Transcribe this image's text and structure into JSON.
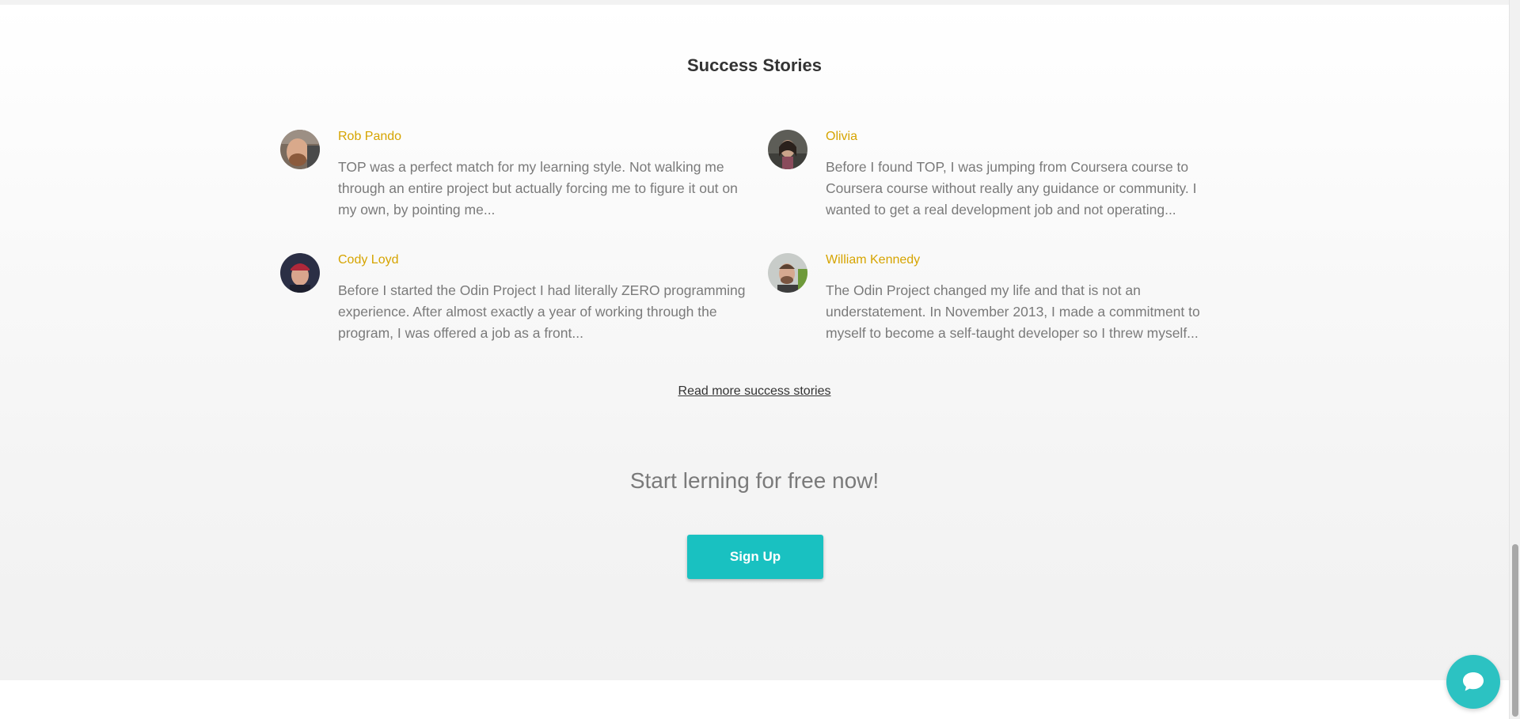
{
  "section": {
    "title": "Success Stories",
    "read_more_label": "Read more success stories"
  },
  "stories": [
    {
      "name": "Rob Pando",
      "quote": "TOP was a perfect match for my learning style. Not walking me through an entire project but actually forcing me to figure it out on my own, by pointing me..."
    },
    {
      "name": "Olivia",
      "quote": "Before I found TOP, I was jumping from Coursera course to Coursera course without really any guidance or community. I wanted to get a real development job and not operating..."
    },
    {
      "name": "Cody Loyd",
      "quote": "Before I started the Odin Project I had literally ZERO programming experience. After almost exactly a year of working through the program, I was offered a job as a front..."
    },
    {
      "name": "William Kennedy",
      "quote": "The Odin Project changed my life and that is not an understatement. In November 2013, I made a commitment to myself to become a self-taught developer so I threw myself..."
    }
  ],
  "cta": {
    "heading": "Start lerning for free now!",
    "signup_label": "Sign Up"
  },
  "icons": {
    "chat": "chat-bubble-icon"
  },
  "colors": {
    "accent": "#19c1c1",
    "name": "#d6a400",
    "text": "#7a7a7a",
    "heading": "#333333"
  }
}
